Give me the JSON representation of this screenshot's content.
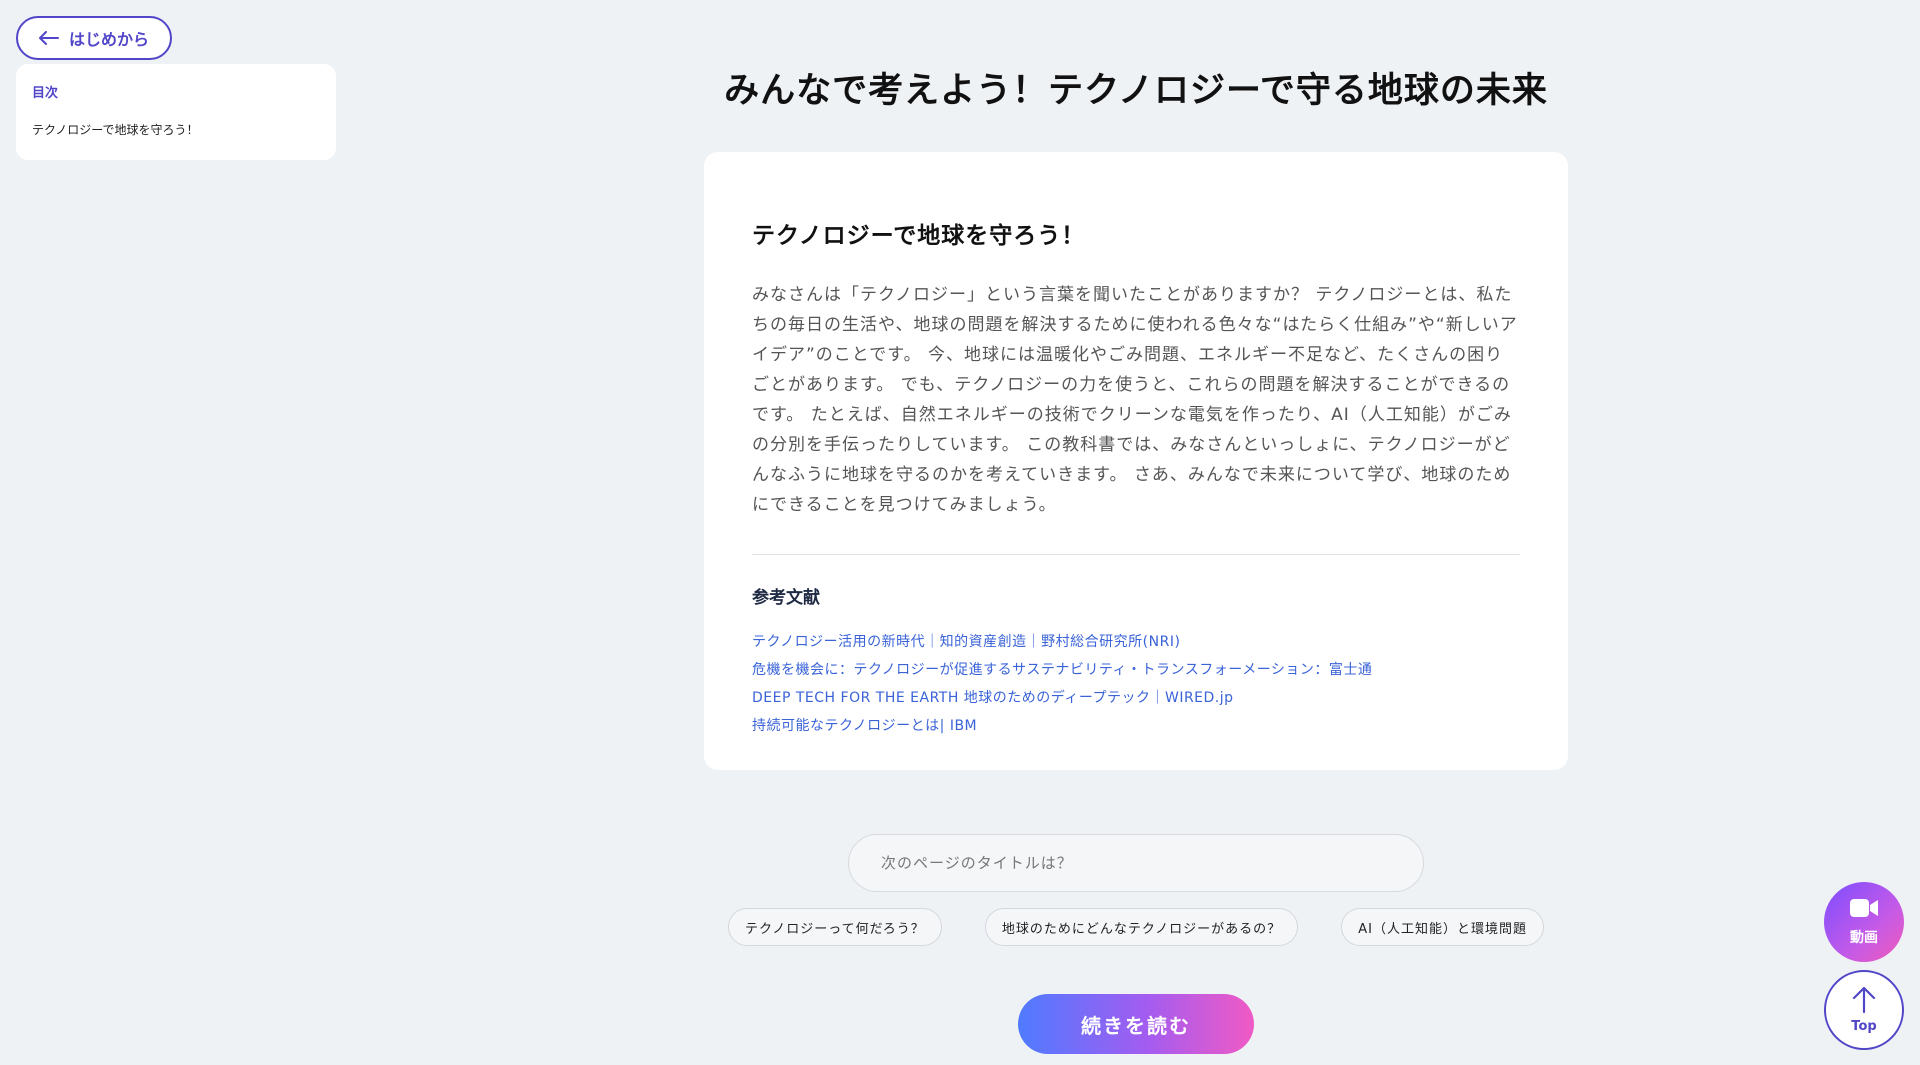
{
  "nav": {
    "back_label": "はじめから"
  },
  "toc": {
    "heading": "目次",
    "items": [
      "テクノロジーで地球を守ろう！"
    ]
  },
  "page": {
    "title": "みんなで考えよう！テクノロジーで守る地球の未来"
  },
  "content": {
    "section_title": "テクノロジーで地球を守ろう！",
    "body": "みなさんは「テクノロジー」という言葉を聞いたことがありますか？ テクノロジーとは、私たちの毎日の生活や、地球の問題を解決するために使われる色々な“はたらく仕組み”や“新しいアイデア”のことです。 今、地球には温暖化やごみ問題、エネルギー不足など、たくさんの困りごとがあります。 でも、テクノロジーの力を使うと、これらの問題を解決することができるのです。 たとえば、自然エネルギーの技術でクリーンな電気を作ったり、AI（人工知能）がごみの分別を手伝ったりしています。 この教科書では、みなさんといっしょに、テクノロジーがどんなふうに地球を守るのかを考えていきます。 さあ、みんなで未来について学び、地球のためにできることを見つけてみましょう。",
    "references_heading": "参考文献",
    "references": [
      "テクノロジー活用の新時代｜知的資産創造｜野村総合研究所(NRI)",
      "危機を機会に：テクノロジーが促進するサステナビリティ・トランスフォーメーション：富士通",
      "DEEP TECH FOR THE EARTH 地球のためのディープテック｜WIRED.jp",
      "持続可能なテクノロジーとは| IBM"
    ]
  },
  "next": {
    "placeholder": "次のページのタイトルは？",
    "suggestions": [
      "テクノロジーって何だろう？",
      "地球のためにどんなテクノロジーがあるの？",
      "AI（人工知能）と環境問題"
    ],
    "read_more_label": "続きを読む"
  },
  "floating": {
    "video_label": "動画",
    "top_label": "Top"
  },
  "colors": {
    "accent": "#5146c8",
    "link": "#3a63d8",
    "background": "#eef2f5"
  }
}
